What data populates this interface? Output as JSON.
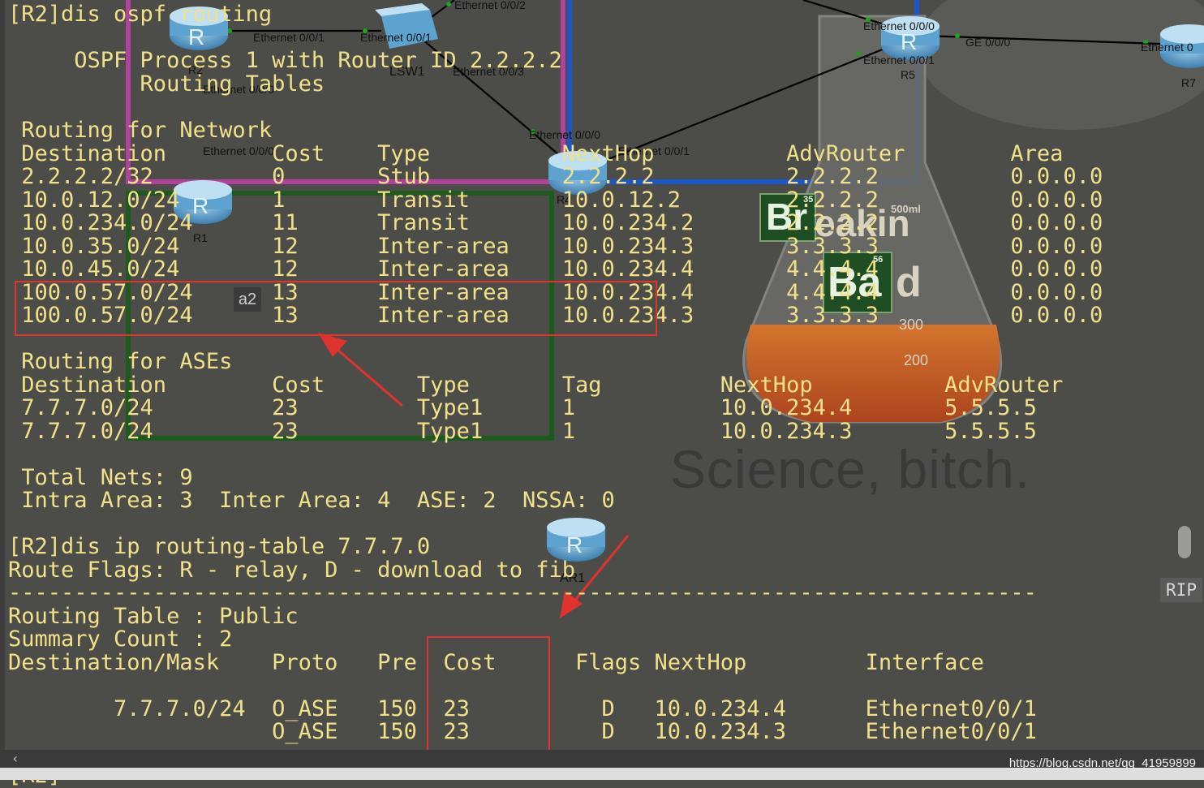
{
  "topology": {
    "labels": {
      "r2": "R2",
      "lsw1": "LSW1",
      "r5": "R5",
      "r7": "R7",
      "r4": "R4",
      "r1": "R1",
      "ar1": "AR1",
      "r2_e001": "Ethernet 0/0/1",
      "lsw_e001": "Ethernet 0/0/1",
      "lsw_e002": "Ethernet 0/0/2",
      "lsw_e003": "Ethernet 0/0/3",
      "r2_e000": "Ethernet 0/0/0",
      "r1_e000": "Ethernet 0/0/0",
      "r4_e000": "Ethernet 0/0/0",
      "r4_e001": "Ethernet 0/0/1",
      "r5_e000": "Ethernet 0/0/0",
      "r5_e001": "Ethernet 0/0/1",
      "r5_ge000": "GE 0/0/0",
      "r7_eth": "Ethernet 0"
    },
    "router_glyph": "R",
    "link_color": "#000000",
    "area_colors": {
      "purple": "#b0419c",
      "blue": "#1b57c8",
      "green": "#1d5a1d"
    }
  },
  "background_art": {
    "logo_br": "Br",
    "logo_br_num": "35",
    "logo_ba": "Ba",
    "logo_ba_num": "56",
    "logo_rest1": "eakin",
    "logo_rest2": "d",
    "flask_tick_500": "500ml",
    "flask_tick_300": "300",
    "flask_tick_200": "200",
    "tagline": "Science, bitch."
  },
  "terminal": {
    "lines": {
      "cmd1": "[R2]dis ospf routing",
      "proc": "     OSPF Process 1 with Router ID 2.2.2.2",
      "tables": "          Routing Tables",
      "net_title": " Routing for Network",
      "net_header": " Destination        Cost    Type          NextHop          AdvRouter        Area",
      "net_r1": " 2.2.2.2/32         0       Stub          2.2.2.2          2.2.2.2          0.0.0.0",
      "net_r2": " 10.0.12.0/24       1       Transit       10.0.12.2        2.2.2.2          0.0.0.0",
      "net_r3": " 10.0.234.0/24      11      Transit       10.0.234.2       2.2.2.2          0.0.0.0",
      "net_r4": " 10.0.35.0/24       12      Inter-area    10.0.234.3       3.3.3.3          0.0.0.0",
      "net_r5": " 10.0.45.0/24       12      Inter-area    10.0.234.4       4.4.4.4          0.0.0.0",
      "net_r6": " 100.0.57.0/24      13      Inter-area    10.0.234.4       4.4.4.4          0.0.0.0",
      "net_r7": " 100.0.57.0/24      13      Inter-area    10.0.234.3       3.3.3.3          0.0.0.0",
      "ase_title": " Routing for ASEs",
      "ase_header": " Destination        Cost       Type       Tag         NextHop          AdvRouter",
      "ase_r1": " 7.7.7.0/24         23         Type1      1           10.0.234.4       5.5.5.5",
      "ase_r2": " 7.7.7.0/24         23         Type1      1           10.0.234.3       5.5.5.5",
      "tot1": " Total Nets: 9",
      "tot2": " Intra Area: 3  Inter Area: 4  ASE: 2  NSSA: 0",
      "cmd2": "[R2]dis ip routing-table 7.7.7.0",
      "flags": "Route Flags: R - relay, D - download to fib",
      "dash": "------------------------------------------------------------------------------",
      "rt_public": "Routing Table : Public",
      "summary": "Summary Count : 2",
      "rt_header": "Destination/Mask    Proto   Pre  Cost      Flags NextHop         Interface",
      "rt_r1": "        7.7.7.0/24  O_ASE   150  23          D   10.0.234.4      Ethernet0/0/1",
      "rt_r2": "                    O_ASE   150  23          D   10.0.234.3      Ethernet0/0/1",
      "prompt": "[R2]"
    }
  },
  "annotations": {
    "tag": "a2",
    "arrow_color": "#e0322e"
  },
  "ui": {
    "rip_button": "RIP",
    "scroll_left": "‹",
    "watermark": "https://blog.csdn.net/qq_41959899"
  }
}
